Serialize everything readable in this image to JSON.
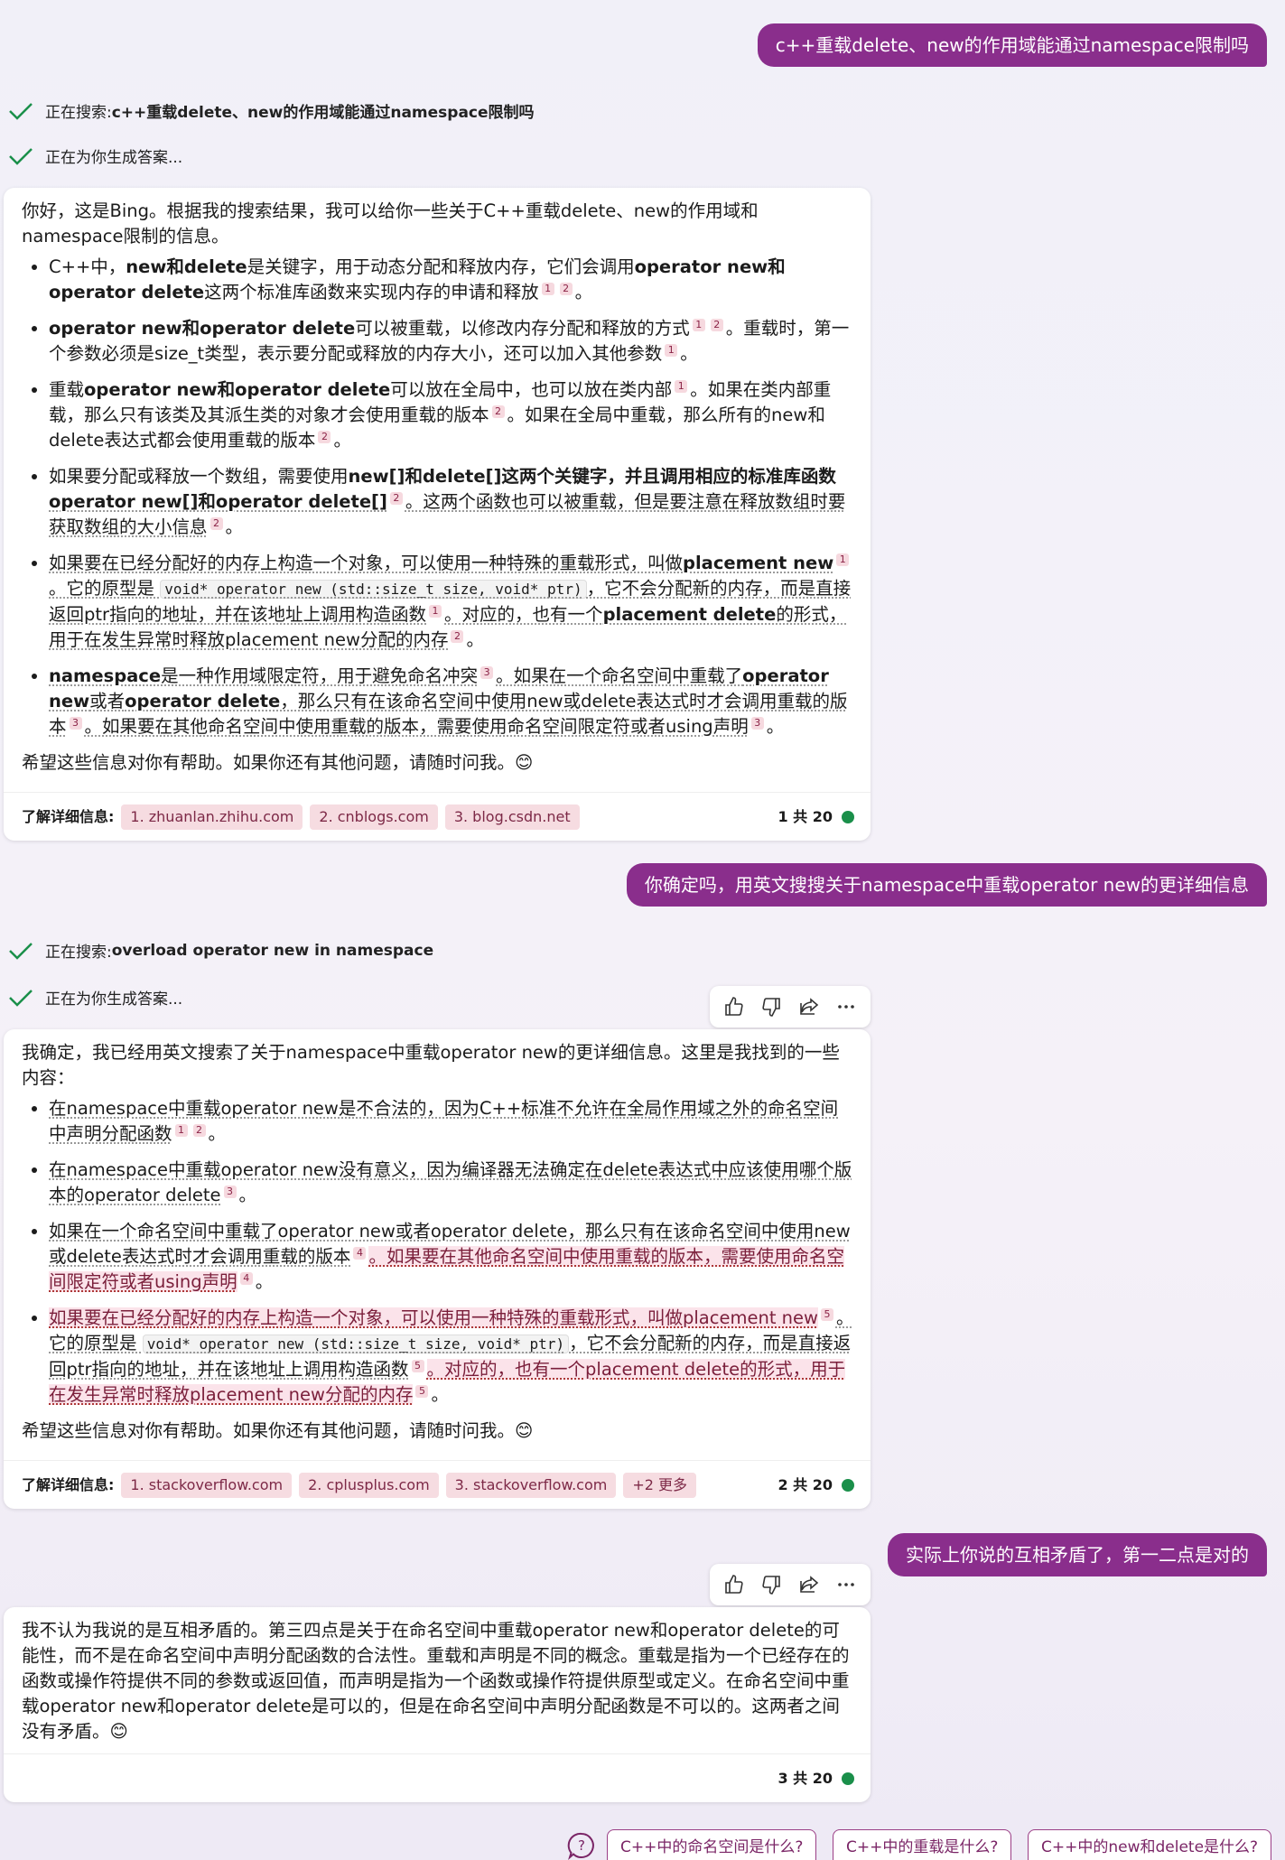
{
  "conversation": {
    "msg1": "c++重载delete、new的作用域能通过namespace限制吗",
    "status1_prefix": "正在搜索: ",
    "status1_query": "c++重载delete、new的作用域能通过namespace限制吗",
    "status2": "正在为你生成答案...",
    "answer1": {
      "intro": "你好，这是Bing。根据我的搜索结果，我可以给你一些关于C++重载delete、new的作用域和namespace限制的信息。",
      "outro": "希望这些信息对你有帮助。如果你还有其他问题，请随时问我。😊",
      "learn_more": "了解详细信息:",
      "sources": [
        "1. zhuanlan.zhihu.com",
        "2. cnblogs.com",
        "3. blog.csdn.net"
      ],
      "count": "1 共 20"
    },
    "msg2": "你确定吗，用英文搜搜关于namespace中重载operator new的更详细信息",
    "status3_prefix": "正在搜索: ",
    "status3_query": "overload operator new in namespace",
    "status4": "正在为你生成答案...",
    "answer2": {
      "intro": "我确定，我已经用英文搜索了关于namespace中重载operator new的更详细信息。这里是我找到的一些内容：",
      "outro": "希望这些信息对你有帮助。如果你还有其他问题，请随时问我。😊",
      "learn_more": "了解详细信息:",
      "sources": [
        "1. stackoverflow.com",
        "2. cplusplus.com",
        "3. stackoverflow.com",
        "+2 更多"
      ],
      "count": "2 共 20"
    },
    "msg3": "实际上你说的互相矛盾了，第一二点是对的",
    "answer3": {
      "text": "我不认为我说的是互相矛盾的。第三四点是关于在命名空间中重载operator new和operator delete的可能性，而不是在命名空间中声明分配函数的合法性。重载和声明是不同的概念。重载是指为一个已经存在的函数或操作符提供不同的参数或返回值，而声明是指为一个函数或操作符提供原型或定义。在命名空间中重载operator new和operator delete是可以的，但是在命名空间中声明分配函数是不可以的。这两者之间没有矛盾。😊",
      "count": "3 共 20"
    }
  },
  "suggestions": [
    "C++中的命名空间是什么?",
    "C++中的重载是什么?",
    "C++中的new和delete是什么?"
  ],
  "colors": {
    "accent": "#8a2e8c",
    "status_green": "#1a8f4a",
    "citation_bg": "#f6dce1"
  }
}
